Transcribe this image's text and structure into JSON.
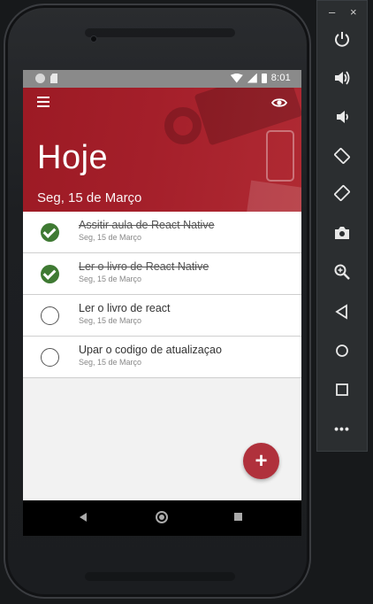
{
  "status_bar": {
    "time": "8:01"
  },
  "header": {
    "title": "Hoje",
    "date": "Seg, 15 de Março"
  },
  "tasks": [
    {
      "desc": "Assitir aula de React Native",
      "date": "Seg, 15 de Março",
      "done": true
    },
    {
      "desc": "Ler o livro de React Native",
      "date": "Seg, 15 de Março",
      "done": true
    },
    {
      "desc": "Ler o livro de react",
      "date": "Seg, 15 de Março",
      "done": false
    },
    {
      "desc": "Upar o codigo de atualizaçao",
      "date": "Seg, 15 de Março",
      "done": false
    }
  ],
  "fab": {
    "label": "+"
  },
  "emulator": {
    "min_label": "–",
    "close_label": "×",
    "more_label": "•••"
  },
  "colors": {
    "header_red": "#a41f2a",
    "done_green": "#3f7a33",
    "fab_red": "#b0313c"
  }
}
